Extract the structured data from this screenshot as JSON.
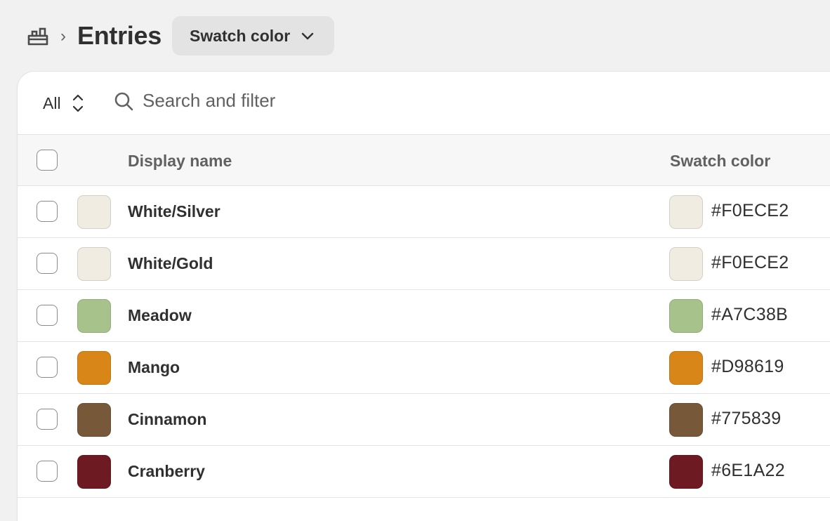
{
  "header": {
    "title": "Entries",
    "separator": "›",
    "definition_button": "Swatch color"
  },
  "filter": {
    "view_label": "All",
    "search_placeholder": "Search and filter"
  },
  "table": {
    "columns": [
      "Display name",
      "Swatch color"
    ],
    "rows": [
      {
        "name": "White/Silver",
        "hex": "#F0ECE2",
        "color": "#F0ECE2"
      },
      {
        "name": "White/Gold",
        "hex": "#F0ECE2",
        "color": "#F0ECE2"
      },
      {
        "name": "Meadow",
        "hex": "#A7C38B",
        "color": "#A7C38B"
      },
      {
        "name": "Mango",
        "hex": "#D98619",
        "color": "#D98619"
      },
      {
        "name": "Cinnamon",
        "hex": "#775839",
        "color": "#775839"
      },
      {
        "name": "Cranberry",
        "hex": "#6E1A22",
        "color": "#6E1A22"
      }
    ]
  }
}
